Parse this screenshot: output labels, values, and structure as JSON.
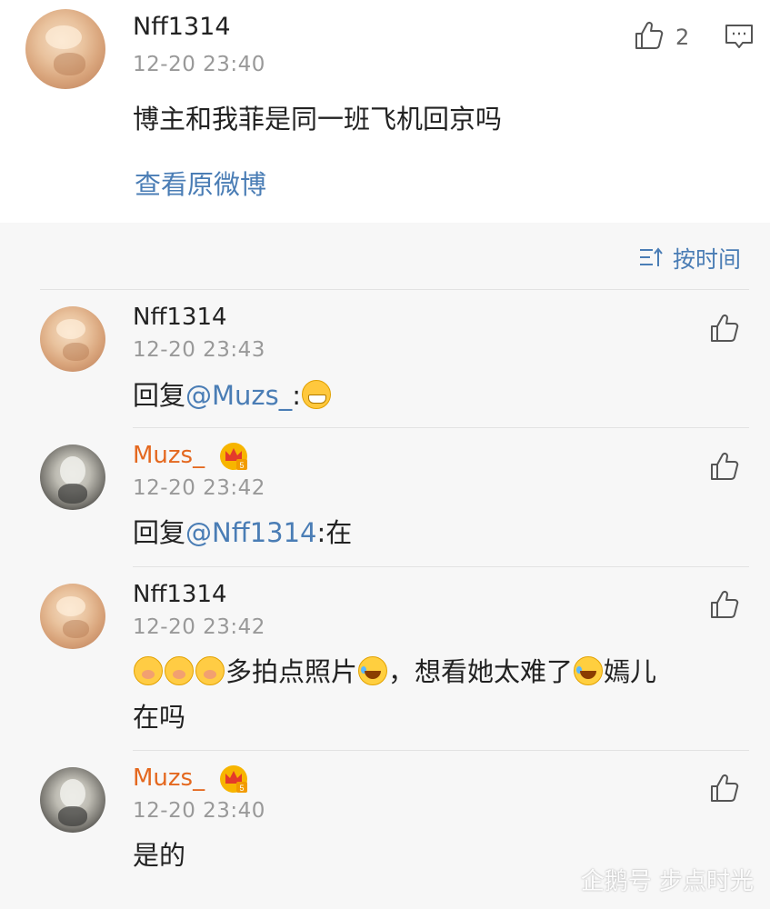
{
  "post": {
    "username": "Nff1314",
    "time": "12-20 23:40",
    "content": "博主和我菲是同一班飞机回京吗",
    "like_count": "2",
    "view_original": "查看原微博"
  },
  "sort": {
    "label": "按时间"
  },
  "replies": [
    {
      "username": "Nff1314",
      "time": "12-20 23:43",
      "prefix": "回复",
      "mention": "@Muzs_",
      "suffix": ":"
    },
    {
      "username": "Muzs_",
      "time": "12-20 23:42",
      "prefix": "回复",
      "mention": "@Nff1314",
      "suffix": ":在"
    },
    {
      "username": "Nff1314",
      "time": "12-20 23:42",
      "text_a": "多拍点照片",
      "text_b": "，想看她太难了",
      "text_c": "嫣儿",
      "text_d": "在吗"
    },
    {
      "username": "Muzs_",
      "time": "12-20 23:40",
      "text": "是的"
    }
  ],
  "watermark": "企鹅号 步点时光",
  "colors": {
    "link": "#4a7db5",
    "vip_name": "#e4681f",
    "time": "#999999"
  }
}
